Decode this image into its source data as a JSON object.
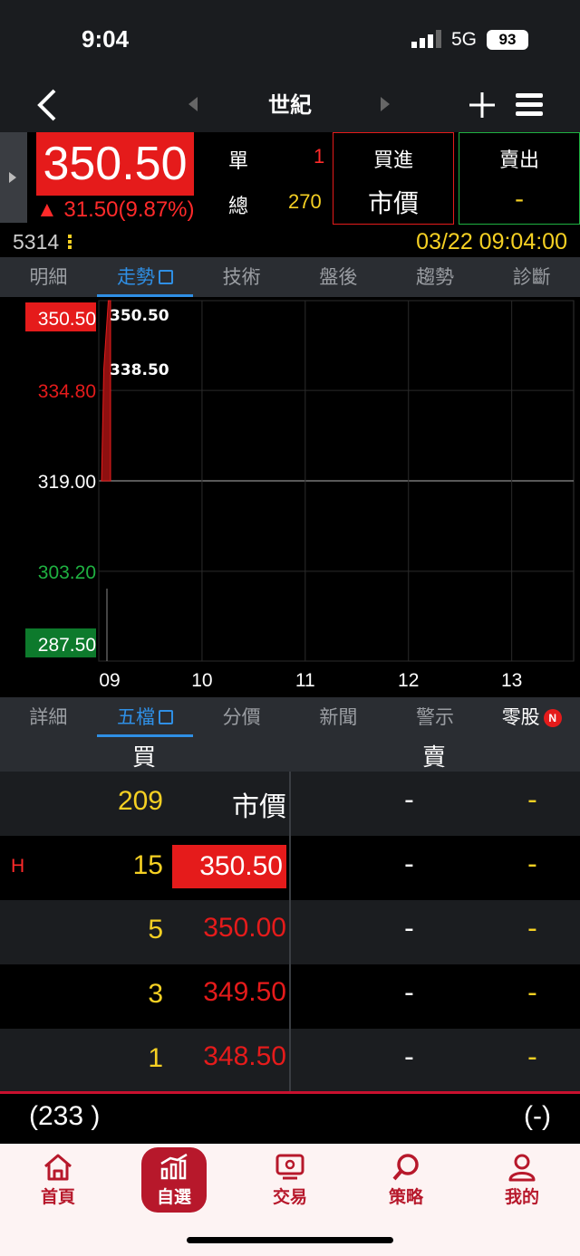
{
  "status": {
    "time": "9:04",
    "network": "5G",
    "battery": "93"
  },
  "nav": {
    "title": "世紀"
  },
  "quote": {
    "price": "350.50",
    "change": "▲ 31.50(9.87%)",
    "single_label": "單",
    "single_value": "1",
    "total_label": "總",
    "total_value": "270",
    "buy_label": "買進",
    "buy_sub": "市價",
    "sell_label": "賣出",
    "sell_sub": "-",
    "code": "5314",
    "datetime": "03/22 09:04:00"
  },
  "colors": {
    "up": "#e51b1b",
    "down": "#1a9e3a",
    "accent": "#2f8fe5",
    "volume": "#f5d023",
    "brand": "#b7182b"
  },
  "top_tabs": [
    {
      "label": "明細"
    },
    {
      "label": "走勢",
      "active": true
    },
    {
      "label": "技術"
    },
    {
      "label": "盤後"
    },
    {
      "label": "趨勢"
    },
    {
      "label": "診斷"
    }
  ],
  "chart_data": {
    "type": "line",
    "y_ticks": [
      "350.50",
      "334.80",
      "319.00",
      "303.20",
      "287.50"
    ],
    "x_ticks": [
      "09",
      "10",
      "11",
      "12",
      "13"
    ],
    "ylim": [
      287.5,
      350.5
    ],
    "high_label": "350.50",
    "low_label": "338.50",
    "reference": 319.0,
    "series": [
      {
        "x": [
          0,
          0.5,
          1.5,
          2
        ],
        "values": [
          319.0,
          338.5,
          350.5,
          350.5
        ]
      }
    ],
    "grid": true
  },
  "bottom_tabs": [
    {
      "label": "詳細"
    },
    {
      "label": "五檔",
      "active": true
    },
    {
      "label": "分價"
    },
    {
      "label": "新聞"
    },
    {
      "label": "警示"
    },
    {
      "label": "零股",
      "badge": "N"
    }
  ],
  "orderbook": {
    "buy_label": "買",
    "sell_label": "賣",
    "rows": [
      {
        "flag": "",
        "qty": "209",
        "price": "市價",
        "sell_price": "-",
        "sell_qty": "-"
      },
      {
        "flag": "H",
        "qty": "15",
        "price": "350.50",
        "sell_price": "-",
        "sell_qty": "-"
      },
      {
        "flag": "",
        "qty": "5",
        "price": "350.00",
        "sell_price": "-",
        "sell_qty": "-"
      },
      {
        "flag": "",
        "qty": "3",
        "price": "349.50",
        "sell_price": "-",
        "sell_qty": "-"
      },
      {
        "flag": "",
        "qty": "1",
        "price": "348.50",
        "sell_price": "-",
        "sell_qty": "-"
      }
    ],
    "buy_total": "(233 )",
    "sell_total": "(-)"
  },
  "bottom_nav": [
    {
      "label": "首頁",
      "icon": "home-icon"
    },
    {
      "label": "自選",
      "icon": "chart-icon",
      "active": true
    },
    {
      "label": "交易",
      "icon": "trade-icon"
    },
    {
      "label": "策略",
      "icon": "search-icon"
    },
    {
      "label": "我的",
      "icon": "user-icon"
    }
  ]
}
